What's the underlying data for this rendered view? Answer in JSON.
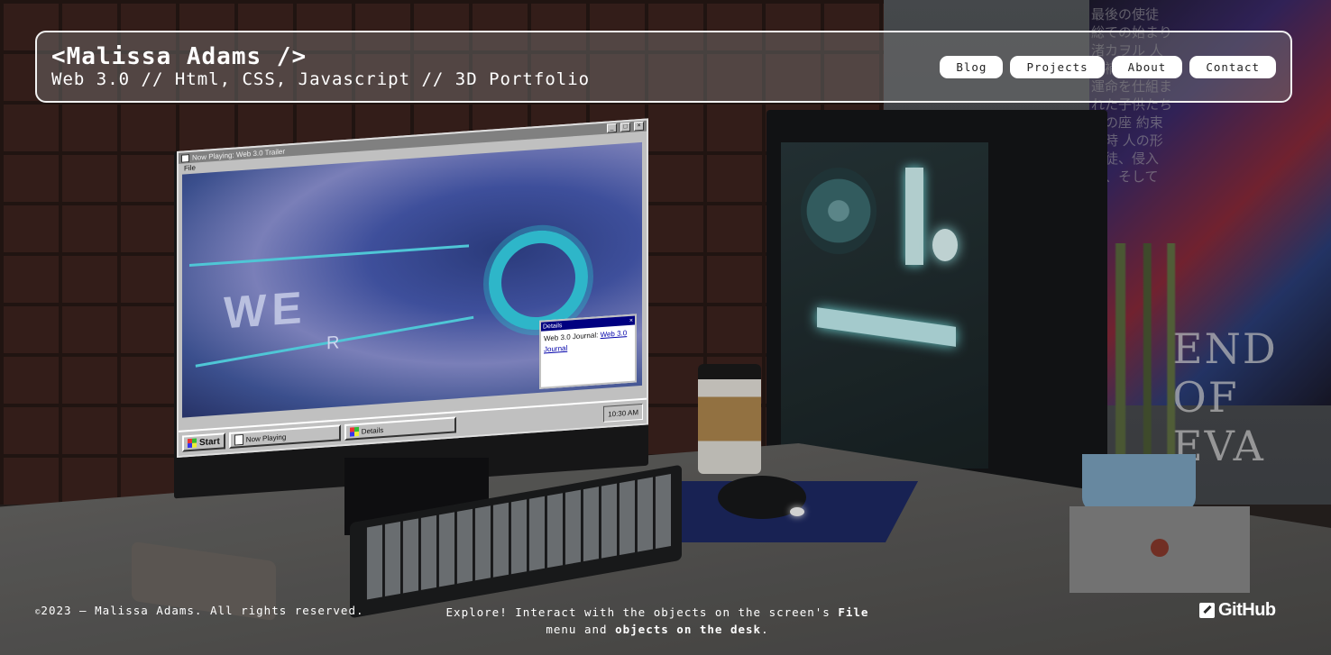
{
  "header": {
    "name": "<Malissa Adams />",
    "subtitle": "Web 3.0 // Html, CSS, Javascript // 3D Portfolio",
    "nav": [
      "Blog",
      "Projects",
      "About",
      "Contact"
    ]
  },
  "screen": {
    "window_title": "Now Playing: Web 3.0 Trailer",
    "menu_label": "File",
    "video_letters": "WE",
    "video_letter_r": "R",
    "details": {
      "title": "Details",
      "text": "Web 3.0 Journal:",
      "link": "Web 3.0 Journal"
    },
    "taskbar": {
      "start": "Start",
      "task1": "Now Playing",
      "task2": "Details",
      "clock": "10:30 AM"
    }
  },
  "poster": {
    "japanese_text": "最後の使徒 総ての始まり 渚カヲル 人類補完計画 運命を仕組まれた子供たち 魂の座 約束の時 人の形 使徒、侵入 死、そして",
    "title": "END OF EVA"
  },
  "footer": {
    "copyright_symbol": "©",
    "copyright": "2023 — Malissa Adams. All rights reserved.",
    "hint_prefix": "Explore! Interact with the objects on the screen's ",
    "hint_file": "File",
    "hint_middle": " menu and ",
    "hint_objects": "objects on the desk",
    "hint_suffix": ".",
    "github": "GitHub"
  },
  "icons": [
    "github-icon",
    "windows-logo-icon",
    "document-icon"
  ],
  "colors": {
    "frame": "#f2f2f2",
    "nav_bg": "#ffffff",
    "win_title": "#000080",
    "neon": "#2eb6c9"
  }
}
